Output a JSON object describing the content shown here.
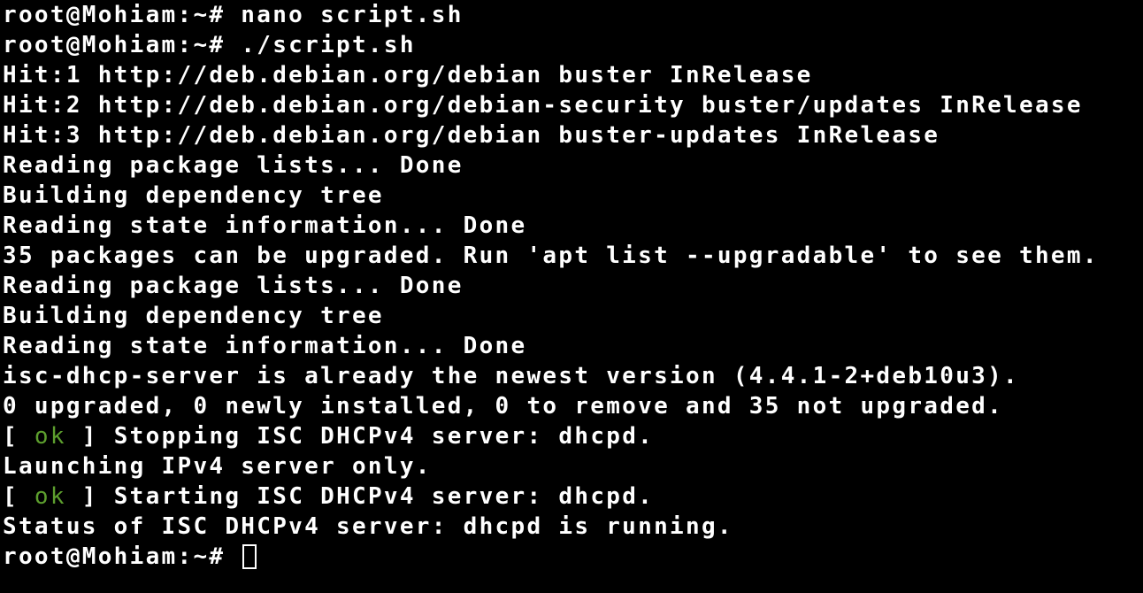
{
  "terminal": {
    "prompt": "root@Mohiam:~# ",
    "lines": [
      "root@Mohiam:~# nano script.sh",
      "root@Mohiam:~# ./script.sh",
      "Hit:1 http://deb.debian.org/debian buster InRelease",
      "Hit:2 http://deb.debian.org/debian-security buster/updates InRelease",
      "Hit:3 http://deb.debian.org/debian buster-updates InRelease",
      "Reading package lists... Done",
      "Building dependency tree",
      "Reading state information... Done",
      "35 packages can be upgraded. Run 'apt list --upgradable' to see them.",
      "Reading package lists... Done",
      "Building dependency tree",
      "Reading state information... Done",
      "isc-dhcp-server is already the newest version (4.4.1-2+deb10u3).",
      "0 upgraded, 0 newly installed, 0 to remove and 35 not upgraded."
    ],
    "status_stop": {
      "open": "[ ",
      "ok": "ok",
      "close": " ] ",
      "text": "Stopping ISC DHCPv4 server: dhcpd."
    },
    "launch_line": "Launching IPv4 server only.",
    "status_start": {
      "open": "[ ",
      "ok": "ok",
      "close": " ] ",
      "text": "Starting ISC DHCPv4 server: dhcpd."
    },
    "final_status": "Status of ISC DHCPv4 server: dhcpd is running.",
    "colors": {
      "background": "#000000",
      "foreground": "#ffffff",
      "ok": "#5d9f2e"
    }
  }
}
